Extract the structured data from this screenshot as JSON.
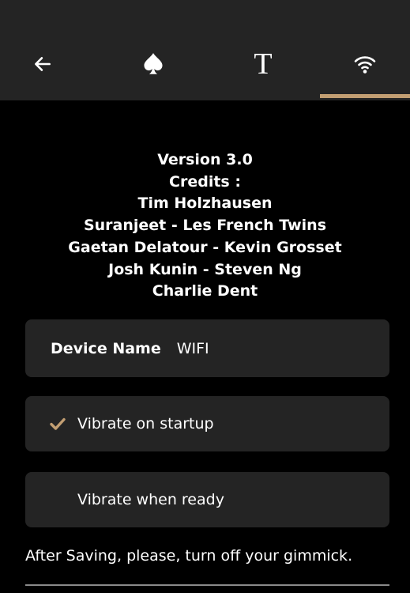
{
  "toolbar": {
    "tabs": [
      {
        "name": "back",
        "icon": "arrow-left-icon"
      },
      {
        "name": "suit",
        "icon": "spade-icon"
      },
      {
        "name": "text",
        "icon": "text-serif-t-icon",
        "glyph": "T"
      },
      {
        "name": "wifi",
        "icon": "wifi-icon",
        "selected": true
      }
    ]
  },
  "credits": {
    "version": "Version 3.0",
    "heading": "Credits :",
    "lines": [
      "Tim Holzhausen",
      "Suranjeet - Les French Twins",
      "Gaetan Delatour - Kevin Grosset",
      "Josh Kunin - Steven Ng",
      "Charlie Dent"
    ]
  },
  "device": {
    "label": "Device Name",
    "value": "WIFI"
  },
  "options": {
    "vibrate_startup": {
      "label": "Vibrate on startup",
      "checked": true
    },
    "vibrate_ready": {
      "label": "Vibrate when ready",
      "checked": false
    }
  },
  "note": "After Saving, please, turn off your gimmick.",
  "colors": {
    "accent": "#c29e72",
    "topbar": "#242424",
    "card": "#242424",
    "background": "#000000"
  }
}
